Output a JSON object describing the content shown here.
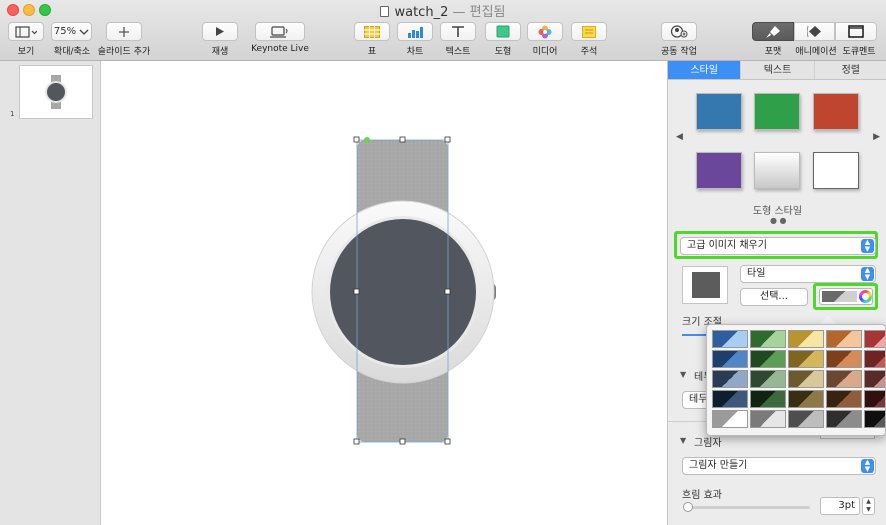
{
  "window": {
    "title": "watch_2",
    "edited": "— 편집됨"
  },
  "toolbar": {
    "view_label": "보기",
    "zoom_value": "75%",
    "zoom_label": "확대/축소",
    "add_slide_label": "슬라이드 추가",
    "play_label": "재생",
    "keynote_live_label": "Keynote Live",
    "table_label": "표",
    "chart_label": "차트",
    "text_label": "텍스트",
    "shape_label": "도형",
    "media_label": "미디어",
    "comment_label": "주석",
    "collaborate_label": "공동 작업",
    "format_label": "포맷",
    "animate_label": "애니메이션",
    "document_label": "도큐멘트"
  },
  "navigator": {
    "slide_number": "1"
  },
  "inspector": {
    "tabs": [
      "스타일",
      "텍스트",
      "정렬"
    ],
    "active_tab": 0,
    "style_swatches": [
      {
        "color": "#3578b0"
      },
      {
        "color": "#2f9f4a"
      },
      {
        "color": "#c0452f"
      },
      {
        "color": "#6a479b"
      },
      {
        "color": "gradient-gray"
      },
      {
        "color": "#ffffff"
      }
    ],
    "shape_styles_label": "도형 스타일",
    "fill_type": "고급 이미지 채우기",
    "scale_mode": "타일",
    "choose_button": "선택...",
    "size_label": "크기 조절",
    "border_label": "테두리",
    "border_popup": "테두",
    "shadow_label": "그림자",
    "shadow_popup": "그림자 만들기",
    "blur_label": "흐림 효과",
    "blur_value": "3pt"
  },
  "colors": {
    "accent": "#3d8ef5",
    "highlight": "#4fd72b",
    "watch_face": "#52565e",
    "strap": "#a8a8a8"
  }
}
